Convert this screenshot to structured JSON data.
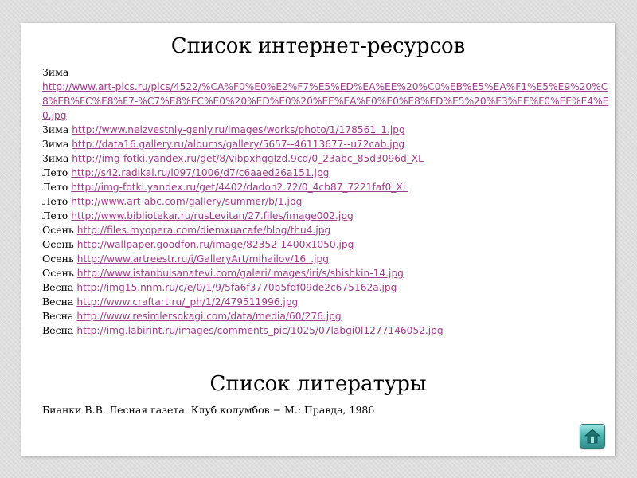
{
  "resources": {
    "title": "Список интернет-ресурсов",
    "items": [
      {
        "season": "Зима",
        "url": "http://www.art-pics.ru/pics/4522/%CA%F0%E0%E2%F7%E5%ED%EA%EE%20%C0%EB%E5%EA%F1%E5%E9%20%C8%EB%FC%E8%F7-%C7%E8%EC%E0%20%ED%E0%20%EE%EA%F0%E0%E8%ED%E5%20%E3%EE%F0%EE%E4%E0.jpg"
      },
      {
        "season": "Зима",
        "url": "http://www.neizvestniy-geniy.ru/images/works/photo/1/178561_1.jpg"
      },
      {
        "season": "Зима",
        "url": "http://data16.gallery.ru/albums/gallery/5657--46113677--u72cab.jpg"
      },
      {
        "season": "Зима",
        "url": "http://img-fotki.yandex.ru/get/8/vibpxhgglzd.9cd/0_23abc_85d3096d_XL"
      },
      {
        "season": "Лето",
        "url": "http://s42.radikal.ru/i097/1006/d7/c6aaed26a151.jpg"
      },
      {
        "season": "Лето",
        "url": "http://img-fotki.yandex.ru/get/4402/dadon2.72/0_4cb87_7221faf0_XL"
      },
      {
        "season": "Лето",
        "url": "http://www.art-abc.com/gallery/summer/b/1.jpg"
      },
      {
        "season": "Лето",
        "url": "http://www.bibliotekar.ru/rusLevitan/27.files/image002.jpg"
      },
      {
        "season": "Осень",
        "url": "http://files.myopera.com/diemxuacafe/blog/thu4.jpg"
      },
      {
        "season": "Осень",
        "url": "http://wallpaper.goodfon.ru/image/82352-1400x1050.jpg"
      },
      {
        "season": "Осень",
        "url": "http://www.artreestr.ru/i/GalleryArt/mihailov/16_.jpg"
      },
      {
        "season": "Осень",
        "url": "http://www.istanbulsanatevi.com/galeri/images/iri/s/shishkin-14.jpg"
      },
      {
        "season": "Весна",
        "url": "http://img15.nnm.ru/c/e/0/1/9/5fa6f3770b5fdf09de2c675162a.jpg"
      },
      {
        "season": "Весна",
        "url": "http://www.craftart.ru/_ph/1/2/479511996.jpg"
      },
      {
        "season": "Весна",
        "url": "http://www.resimlersokagi.com/data/media/60/276.jpg"
      },
      {
        "season": "Весна",
        "url": "http://img.labirint.ru/images/comments_pic/1025/07labgi0l1277146052.jpg"
      }
    ]
  },
  "literature": {
    "title": "Список литературы",
    "entry": "Бианки В.В. Лесная газета. Клуб колумбов − М.: Правда, 1986"
  },
  "nav": {
    "icon": "home-icon",
    "accent_color": "#4fb7b4"
  },
  "colors": {
    "link": "#a23c8c",
    "text": "#000000",
    "slide_background": "#ffffff",
    "page_background": "#dedede"
  }
}
